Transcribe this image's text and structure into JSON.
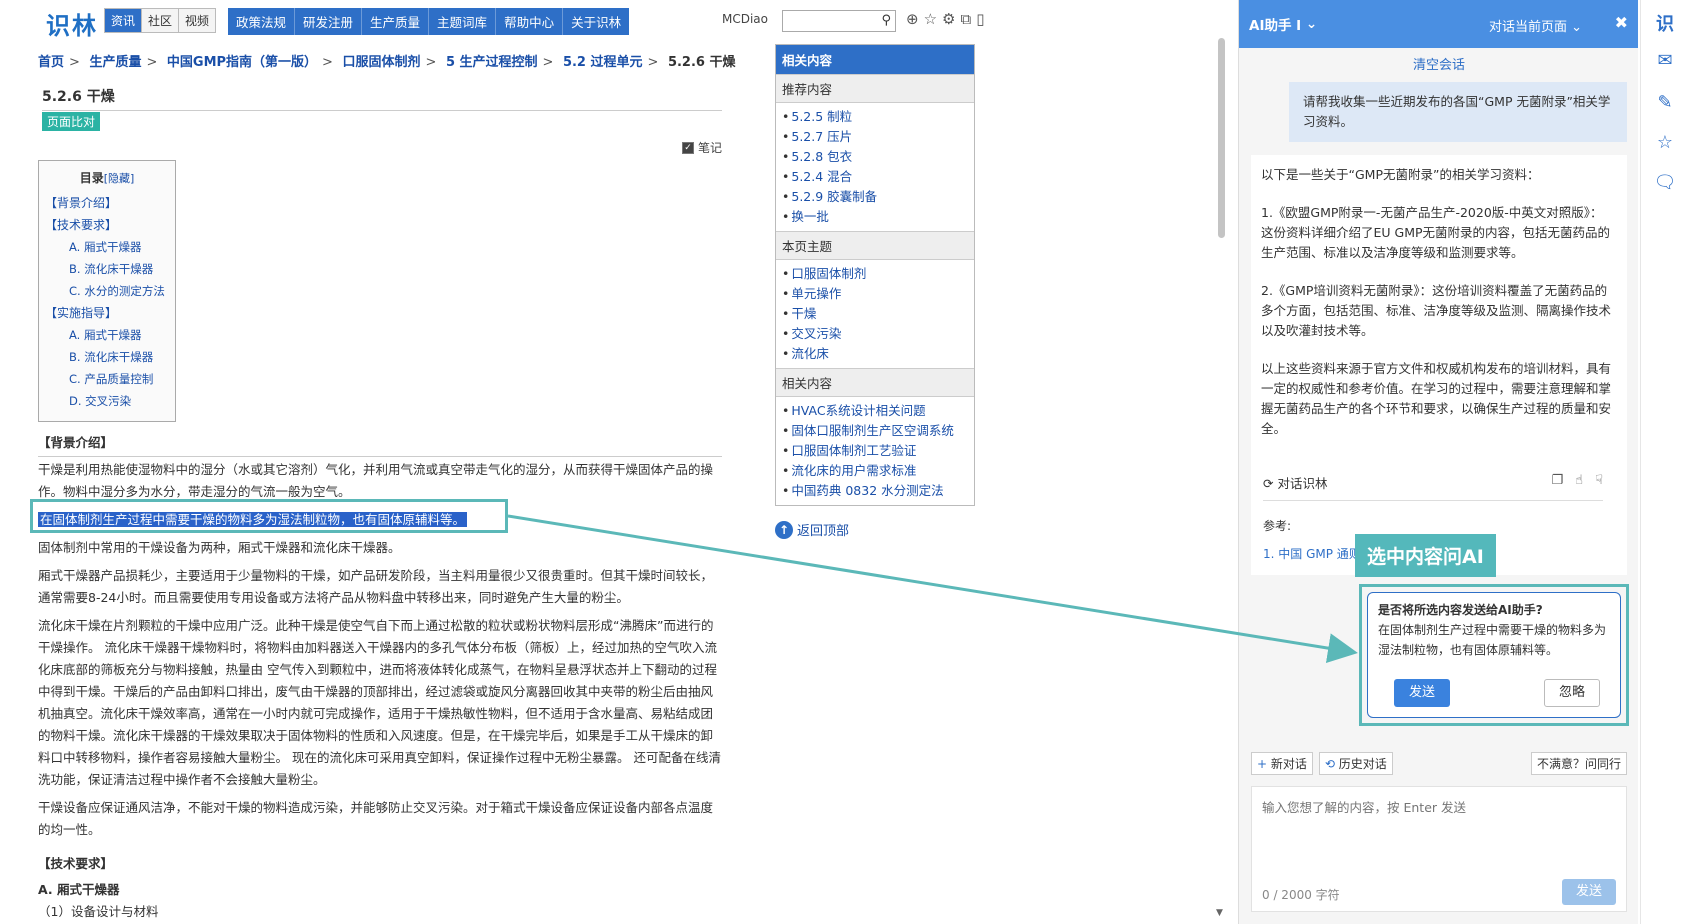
{
  "site": {
    "logo": "识林",
    "subnav": [
      "资讯",
      "社区",
      "视频"
    ],
    "mainnav": [
      "政策法规",
      "研发注册",
      "生产质量",
      "主题词库",
      "帮助中心",
      "关于识林"
    ],
    "username": "MCDiao",
    "search_placeholder": "",
    "icons": [
      "zoom-icon",
      "star-icon",
      "gear-icon",
      "share-icon",
      "mobile-icon"
    ]
  },
  "breadcrumb": [
    "首页",
    "生产质量",
    "中国GMP指南（第一版）",
    "口服固体制剂",
    "5 生产过程控制",
    "5.2 过程单元",
    "5.2.6 干燥"
  ],
  "page": {
    "title": "5.2.6 干燥",
    "compare_label": "页面比对",
    "note_label": "笔记"
  },
  "toc": {
    "title": "目录",
    "hide": "[隐藏]",
    "items": [
      {
        "level": 1,
        "label": "【背景介绍】"
      },
      {
        "level": 1,
        "label": "【技术要求】"
      },
      {
        "level": 2,
        "label": "A. 厢式干燥器"
      },
      {
        "level": 2,
        "label": "B. 流化床干燥器"
      },
      {
        "level": 2,
        "label": "C. 水分的测定方法"
      },
      {
        "level": 1,
        "label": "【实施指导】"
      },
      {
        "level": 2,
        "label": "A. 厢式干燥器"
      },
      {
        "level": 2,
        "label": "B. 流化床干燥器"
      },
      {
        "level": 2,
        "label": "C. 产品质量控制"
      },
      {
        "level": 2,
        "label": "D. 交叉污染"
      }
    ]
  },
  "article": {
    "bg_heading": "【背景介绍】",
    "p1": "干燥是利用热能使湿物料中的湿分（水或其它溶剂）气化，并利用气流或真空带走气化的湿分，从而获得干燥固体产品的操作。物料中湿分多为水分，带走湿分的气流一般为空气。",
    "p2_selected": "在固体制剂生产过程中需要干燥的物料多为湿法制粒物，也有固体原辅料等。",
    "p3": "固体制剂中常用的干燥设备为两种，厢式干燥器和流化床干燥器。",
    "p4": "厢式干燥器产品损耗少，主要适用于少量物料的干燥，如产品研发阶段，当主料用量很少又很贵重时。但其干燥时间较长，通常需要8-24小时。而且需要使用专用设备或方法将产品从物料盘中转移出来，同时避免产生大量的粉尘。",
    "p5": "流化床干燥在片剂颗粒的干燥中应用广泛。此种干燥是使空气自下而上通过松散的粒状或粉状物料层形成“沸腾床”而进行的干燥操作。 流化床干燥器干燥物料时，将物料由加料器送入干燥器内的多孔气体分布板（筛板）上，经过加热的空气吹入流化床底部的筛板充分与物料接触，热量由 空气传入到颗粒中，进而将液体转化成蒸气，在物料呈悬浮状态并上下翻动的过程中得到干燥。干燥后的产品由卸料口排出，废气由干燥器的顶部排出，经过滤袋或旋风分离器回收其中夹带的粉尘后由抽风机抽真空。流化床干燥效率高，通常在一小时内就可完成操作，适用于干燥热敏性物料，但不适用于含水量高、易粘结成团的物料干燥。流化床干燥器的干燥效果取决于固体物料的性质和入风速度。但是，在干燥完毕后，如果是手工从干燥床的卸料口中转移物料，操作者容易接触大量粉尘。 现在的流化床可采用真空卸料，保证操作过程中无粉尘暴露。 还可配备在线清洗功能，保证清洁过程中操作者不会接触大量粉尘。",
    "p6": "干燥设备应保证通风洁净，不能对干燥的物料造成污染，并能够防止交叉污染。对于箱式干燥设备应保证设备内部各点温度的均一性。",
    "tech_heading": "【技术要求】",
    "sub_a": "A. 厢式干燥器",
    "sub_a1": "（1）设备设计与材料"
  },
  "related": {
    "header": "相关内容",
    "sections": [
      {
        "title": "推荐内容",
        "items": [
          "5.2.5 制粒",
          "5.2.7 压片",
          "5.2.8 包衣",
          "5.2.4 混合",
          "5.2.9 胶囊制备",
          "换一批"
        ]
      },
      {
        "title": "本页主题",
        "items": [
          "口服固体制剂",
          "单元操作",
          "干燥",
          "交叉污染",
          "流化床"
        ]
      },
      {
        "title": "相关内容",
        "items": [
          "HVAC系统设计相关问题",
          "固体口服制剂生产区空调系统",
          "口服固体制剂工艺验证",
          "流化床的用户需求标准",
          "中国药典 0832 水分测定法"
        ]
      }
    ],
    "back_top": "返回顶部"
  },
  "ai": {
    "title": "AI助手 I",
    "scope": "对话当前页面",
    "clear": "清空会话",
    "user_msg": "请帮我收集一些近期发布的各国“GMP 无菌附录”相关学习资料。",
    "answer": [
      "以下是一些关于“GMP无菌附录”的相关学习资料：",
      "1.《欧盟GMP附录一-无菌产品生产-2020版-中英文对照版》： 这份资料详细介绍了EU GMP无菌附录的内容，包括无菌药品的生产范围、标准以及洁净度等级和监测要求等。",
      "2.《GMP培训资料无菌附录》：这份培训资料覆盖了无菌药品的多个方面，包括范围、标准、洁净度等级及监测、隔离操作技术以及吹灌封技术等。",
      "以上这些资料来源于官方文件和权威机构发布的培训材料，具有一定的权威性和参考价值。在学习的过程中，需要注意理解和掌握无菌药品生产的各个环节和要求，以确保生产过程的质量和安全。"
    ],
    "chat_shilin": "对话识林",
    "ref_label": "参考:",
    "ref_item": "1. 中国 GMP 通则",
    "ask_label": "选中内容问AI",
    "confirm_q": "是否将所选内容发送给AI助手?",
    "confirm_text": "在固体制剂生产过程中需要干燥的物料多为湿法制粒物，也有固体原辅料等。",
    "send": "发送",
    "ignore": "忽略",
    "new_chat": "新对话",
    "history": "历史对话",
    "ask_peer": "不满意？问同行",
    "input_placeholder": "输入您想了解的内容，按 Enter 发送",
    "counter": "0 / 2000 字符",
    "send2": "发送"
  },
  "right_bar": {
    "logo": "识",
    "icons": [
      "mail-icon",
      "edit-icon",
      "star-icon",
      "comment-icon"
    ]
  }
}
